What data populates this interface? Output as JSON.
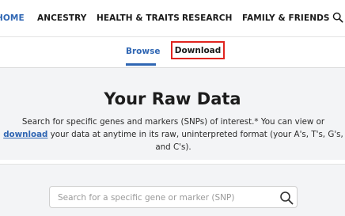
{
  "nav": {
    "items": [
      {
        "label": "HOME"
      },
      {
        "label": "ANCESTRY"
      },
      {
        "label": "HEALTH & TRAITS"
      },
      {
        "label": "RESEARCH"
      },
      {
        "label": "FAMILY & FRIENDS"
      }
    ],
    "search_icon": "search-icon"
  },
  "subnav": {
    "tabs": [
      {
        "label": "Browse",
        "active": true
      },
      {
        "label": "Download",
        "highlighted": true
      }
    ]
  },
  "main": {
    "title": "Your Raw Data",
    "desc_before": "Search for specific genes and markers (SNPs) of interest.* You can view or ",
    "desc_link": "download",
    "desc_after": " your data at anytime in its raw, uninterpreted format (your A's, T's, G's, and C's)."
  },
  "search": {
    "placeholder": "Search for a specific gene or marker (SNP)",
    "icon": "search-icon"
  },
  "colors": {
    "accent": "#2f66b3",
    "highlight_border": "#e0241f",
    "page_bg": "#f3f4f6"
  }
}
